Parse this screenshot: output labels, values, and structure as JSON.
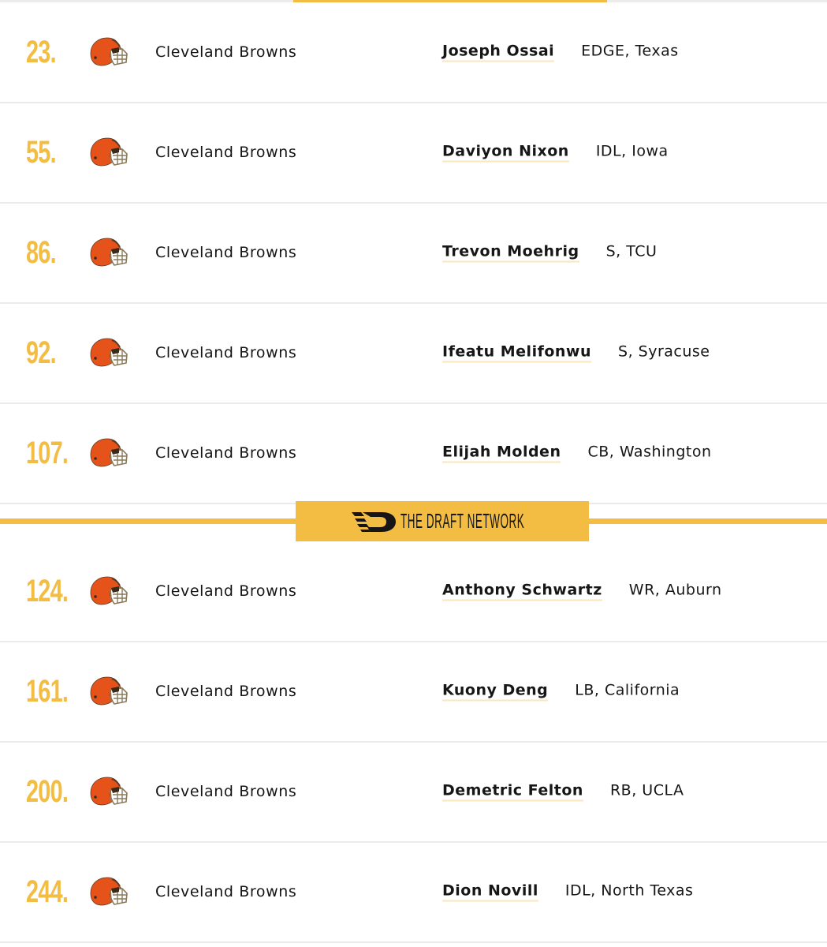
{
  "brand": {
    "name": "THE DRAFT NETWORK",
    "accent_color": "#f2bd42",
    "helmet_color": "#e5531b"
  },
  "picks_top": [
    {
      "pick": "23.",
      "team": "Cleveland Browns",
      "player": "Joseph Ossai",
      "position": "EDGE, Texas"
    },
    {
      "pick": "55.",
      "team": "Cleveland Browns",
      "player": "Daviyon Nixon",
      "position": "IDL, Iowa"
    },
    {
      "pick": "86.",
      "team": "Cleveland Browns",
      "player": "Trevon Moehrig",
      "position": "S, TCU"
    },
    {
      "pick": "92.",
      "team": "Cleveland Browns",
      "player": "Ifeatu Melifonwu",
      "position": "S, Syracuse"
    },
    {
      "pick": "107.",
      "team": "Cleveland Browns",
      "player": "Elijah Molden",
      "position": "CB, Washington"
    }
  ],
  "picks_bottom": [
    {
      "pick": "124.",
      "team": "Cleveland Browns",
      "player": "Anthony Schwartz",
      "position": "WR, Auburn"
    },
    {
      "pick": "161.",
      "team": "Cleveland Browns",
      "player": "Kuony Deng",
      "position": "LB, California"
    },
    {
      "pick": "200.",
      "team": "Cleveland Browns",
      "player": "Demetric Felton",
      "position": "RB, UCLA"
    },
    {
      "pick": "244.",
      "team": "Cleveland Browns",
      "player": "Dion Novill",
      "position": "IDL, North Texas"
    }
  ]
}
